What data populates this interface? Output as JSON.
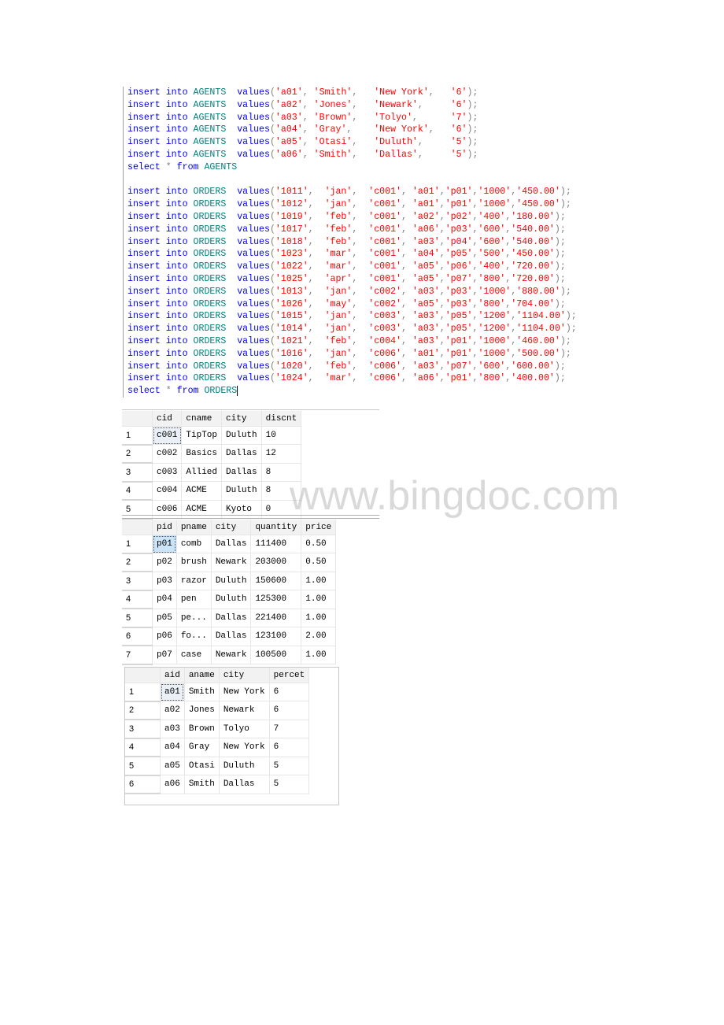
{
  "editor": {
    "agents_inserts": [
      [
        "a01",
        "Smith",
        "New York",
        "6"
      ],
      [
        "a02",
        "Jones",
        "Newark",
        "6"
      ],
      [
        "a03",
        "Brown",
        "Tolyo",
        "7"
      ],
      [
        "a04",
        "Gray",
        "New York",
        "6"
      ],
      [
        "a05",
        "Otasi",
        "Duluth",
        "5"
      ],
      [
        "a06",
        "Smith",
        "Dallas",
        "5"
      ]
    ],
    "agents_table": "AGENTS",
    "orders_table": "ORDERS",
    "kw_insert": "insert",
    "kw_into": "into",
    "kw_values": "values",
    "kw_select": "select",
    "kw_star": "*",
    "kw_from": "from",
    "orders_inserts": [
      [
        "1011",
        "jan",
        "c001",
        "a01",
        "p01",
        "1000",
        "450.00"
      ],
      [
        "1012",
        "jan",
        "c001",
        "a01",
        "p01",
        "1000",
        "450.00"
      ],
      [
        "1019",
        "feb",
        "c001",
        "a02",
        "p02",
        "400",
        "180.00"
      ],
      [
        "1017",
        "feb",
        "c001",
        "a06",
        "p03",
        "600",
        "540.00"
      ],
      [
        "1018",
        "feb",
        "c001",
        "a03",
        "p04",
        "600",
        "540.00"
      ],
      [
        "1023",
        "mar",
        "c001",
        "a04",
        "p05",
        "500",
        "450.00"
      ],
      [
        "1022",
        "mar",
        "c001",
        "a05",
        "p06",
        "400",
        "720.00"
      ],
      [
        "1025",
        "apr",
        "c001",
        "a05",
        "p07",
        "800",
        "720.00"
      ],
      [
        "1013",
        "jan",
        "c002",
        "a03",
        "p03",
        "1000",
        "880.00"
      ],
      [
        "1026",
        "may",
        "c002",
        "a05",
        "p03",
        "800",
        "704.00"
      ],
      [
        "1015",
        "jan",
        "c003",
        "a03",
        "p05",
        "1200",
        "1104.00"
      ],
      [
        "1014",
        "jan",
        "c003",
        "a03",
        "p05",
        "1200",
        "1104.00"
      ],
      [
        "1021",
        "feb",
        "c004",
        "a03",
        "p01",
        "1000",
        "460.00"
      ],
      [
        "1016",
        "jan",
        "c006",
        "a01",
        "p01",
        "1000",
        "500.00"
      ],
      [
        "1020",
        "feb",
        "c006",
        "a03",
        "p07",
        "600",
        "600.00"
      ],
      [
        "1024",
        "mar",
        "c006",
        "a06",
        "p01",
        "800",
        "400.00"
      ]
    ]
  },
  "customers_grid": {
    "columns": [
      "cid",
      "cname",
      "city",
      "discnt"
    ],
    "rows": [
      [
        "1",
        "c001",
        "TipTop",
        "Duluth",
        "10"
      ],
      [
        "2",
        "c002",
        "Basics",
        "Dallas",
        "12"
      ],
      [
        "3",
        "c003",
        "Allied",
        "Dallas",
        "8"
      ],
      [
        "4",
        "c004",
        "ACME",
        "Duluth",
        "8"
      ],
      [
        "5",
        "c006",
        "ACME",
        "Kyoto",
        "0"
      ]
    ]
  },
  "products_grid": {
    "columns": [
      "pid",
      "pname",
      "city",
      "quantity",
      "price"
    ],
    "rows": [
      [
        "1",
        "p01",
        "comb",
        "Dallas",
        "111400",
        "0.50"
      ],
      [
        "2",
        "p02",
        "brush",
        "Newark",
        "203000",
        "0.50"
      ],
      [
        "3",
        "p03",
        "razor",
        "Duluth",
        "150600",
        "1.00"
      ],
      [
        "4",
        "p04",
        "pen",
        "Duluth",
        "125300",
        "1.00"
      ],
      [
        "5",
        "p05",
        "pe...",
        "Dallas",
        "221400",
        "1.00"
      ],
      [
        "6",
        "p06",
        "fo...",
        "Dallas",
        "123100",
        "2.00"
      ],
      [
        "7",
        "p07",
        "case",
        "Newark",
        "100500",
        "1.00"
      ]
    ]
  },
  "agents_grid": {
    "columns": [
      "aid",
      "aname",
      "city",
      "percet"
    ],
    "rows": [
      [
        "1",
        "a01",
        "Smith",
        "New York",
        "6"
      ],
      [
        "2",
        "a02",
        "Jones",
        "Newark",
        "6"
      ],
      [
        "3",
        "a03",
        "Brown",
        "Tolyo",
        "7"
      ],
      [
        "4",
        "a04",
        "Gray",
        "New York",
        "6"
      ],
      [
        "5",
        "a05",
        "Otasi",
        "Duluth",
        "5"
      ],
      [
        "6",
        "a06",
        "Smith",
        "Dallas",
        "5"
      ]
    ]
  },
  "watermark": "www.bingdoc.com",
  "colors": {
    "keyword": "#0000ff",
    "object": "#008080",
    "string": "#ff0000",
    "punctuation": "#808080"
  }
}
